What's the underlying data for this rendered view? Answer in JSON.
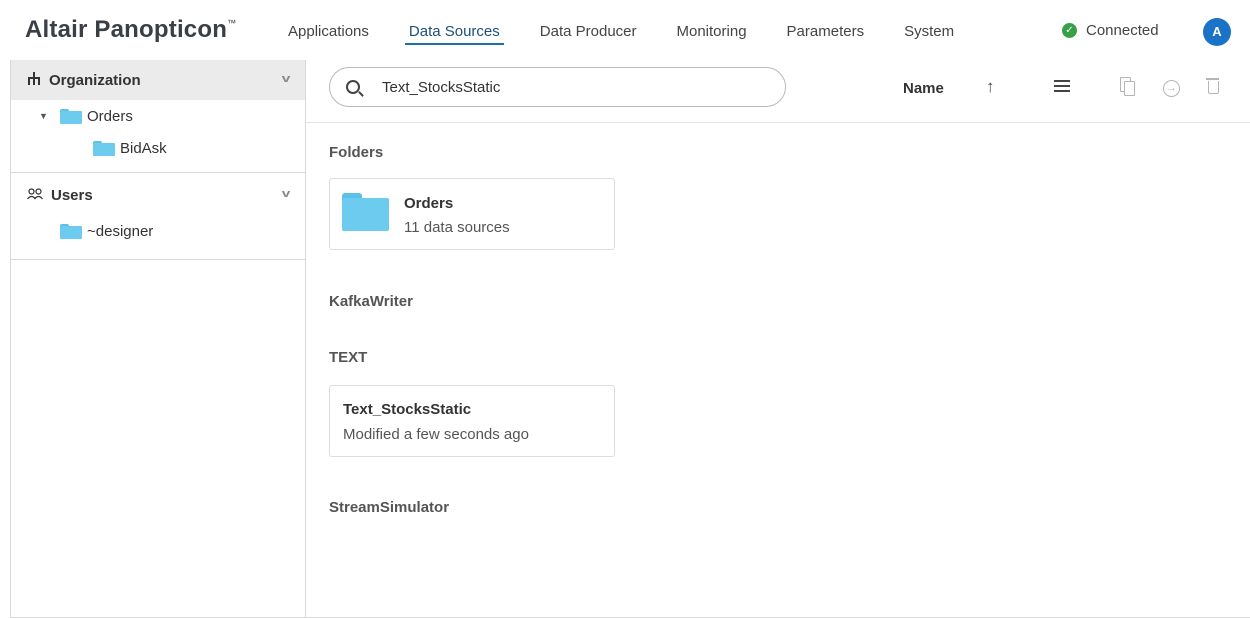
{
  "app": {
    "brand": "Altair Panopticon",
    "brand_mark": "™"
  },
  "nav": {
    "items": [
      {
        "label": "Applications"
      },
      {
        "label": "Data Sources",
        "active": true
      },
      {
        "label": "Data Producer"
      },
      {
        "label": "Monitoring"
      },
      {
        "label": "Parameters"
      },
      {
        "label": "System"
      }
    ]
  },
  "status": {
    "label": "Connected",
    "color": "#3aa047"
  },
  "user": {
    "avatar_letter": "A",
    "avatar_color": "#1a73c7"
  },
  "sidebar": {
    "organization": {
      "title": "Organization",
      "icon": "hierarchy-icon",
      "tree": [
        {
          "label": "Orders",
          "expanded": true,
          "children": [
            {
              "label": "BidAsk"
            }
          ]
        }
      ]
    },
    "users": {
      "title": "Users",
      "icon": "users-icon",
      "tree": [
        {
          "label": "~designer"
        }
      ]
    }
  },
  "search": {
    "value": "Text_StocksStatic"
  },
  "sort": {
    "label": "Name",
    "direction": "ascending"
  },
  "groups": {
    "folders": {
      "title": "Folders",
      "card": {
        "title": "Orders",
        "subtitle": "11 data sources"
      }
    },
    "kafka": {
      "title": "KafkaWriter"
    },
    "text": {
      "title": "TEXT",
      "card": {
        "title": "Text_StocksStatic",
        "subtitle": "Modified a few seconds ago"
      }
    },
    "stream": {
      "title": "StreamSimulator"
    }
  }
}
